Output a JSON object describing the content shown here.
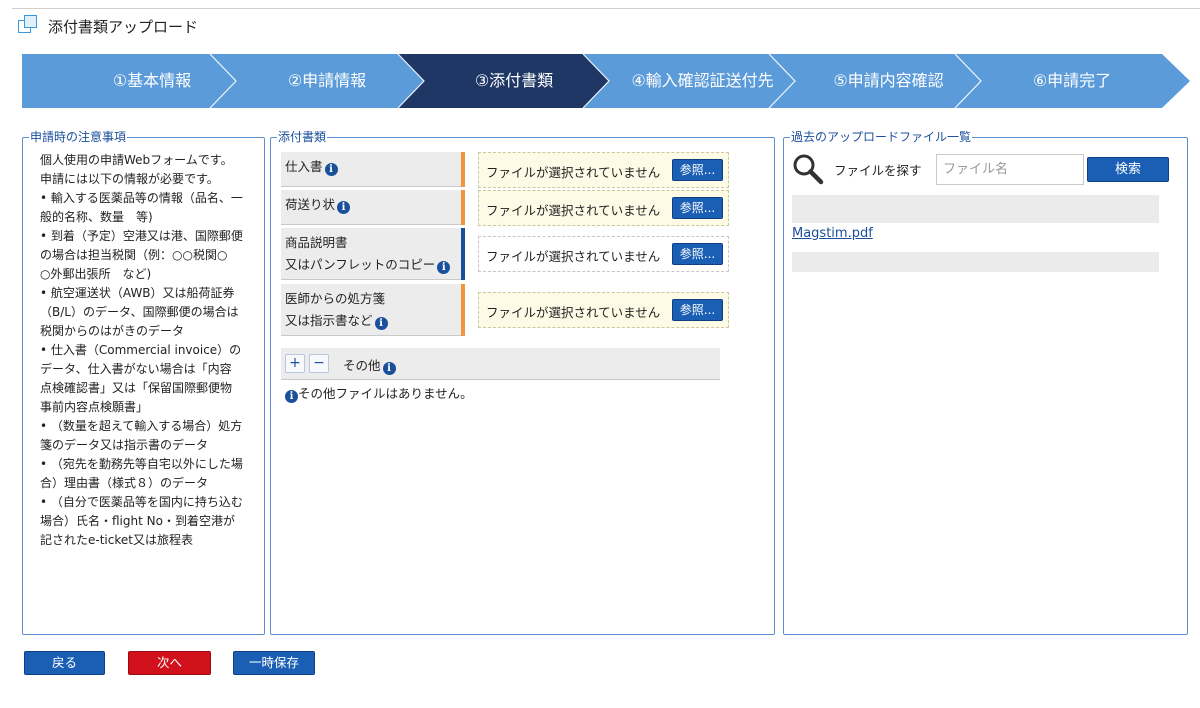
{
  "header": {
    "title": "添付書類アップロード"
  },
  "steps": [
    {
      "label": "①基本情報",
      "active": false
    },
    {
      "label": "②申請情報",
      "active": false
    },
    {
      "label": "③添付書類",
      "active": true
    },
    {
      "label": "④輸入確認証送付先",
      "active": false
    },
    {
      "label": "⑤申請内容確認",
      "active": false
    },
    {
      "label": "⑥申請完了",
      "active": false
    }
  ],
  "colors": {
    "step_inactive": "#5b9bd9",
    "step_active": "#1e3764",
    "accent": "#1a5fb4",
    "next_button": "#d0101b"
  },
  "notice": {
    "legend": "申請時の注意事項",
    "lines": [
      "個人使用の申請Webフォームです。",
      "申請には以下の情報が必要です。",
      "• 輸入する医薬品等の情報（品名、一",
      "般的名称、数量　等)",
      "• 到着（予定）空港又は港、国際郵便",
      "の場合は担当税関（例：○○税関○",
      "○外郵出張所　など)",
      "• 航空運送状（AWB）又は船荷証券",
      "（B/L）のデータ、国際郵便の場合は",
      "税関からのはがきのデータ",
      "• 仕入書（Commercial invoice）の",
      "データ、仕入書がない場合は「内容",
      "点検確認書」又は「保留国際郵便物",
      "事前内容点検願書」",
      "• （数量を超えて輸入する場合）処方",
      "箋のデータ又は指示書のデータ",
      "• （宛先を勤務先等自宅以外にした場",
      "合）理由書（様式８）のデータ",
      "• （自分で医薬品等を国内に持ち込む",
      "場合）氏名・flight No・到着空港が",
      "記されたe-ticket又は旅程表"
    ]
  },
  "attachments": {
    "legend": "添付書類",
    "docs": [
      {
        "line1": "仕入書",
        "line2": "",
        "file_status": "ファイルが選択されていません",
        "browse_label": "参照..."
      },
      {
        "line1": "荷送り状",
        "line2": "",
        "file_status": "ファイルが選択されていません",
        "browse_label": "参照..."
      },
      {
        "line1": "商品説明書",
        "line2": "又はパンフレットのコピー",
        "file_status": "ファイルが選択されていません",
        "browse_label": "参照..."
      },
      {
        "line1": "医師からの処方箋",
        "line2": "又は指示書など",
        "file_status": "ファイルが選択されていません",
        "browse_label": "参照..."
      }
    ],
    "other": {
      "plus": "+",
      "minus": "−",
      "label": "その他",
      "note": "その他ファイルはありません。"
    }
  },
  "past_uploads": {
    "legend": "過去のアップロードファイル一覧",
    "search_label": "ファイルを探す",
    "search_placeholder": "ファイル名",
    "search_button": "検索",
    "files": [
      "Magstim.pdf"
    ]
  },
  "footer": {
    "back": "戻る",
    "next": "次へ",
    "save": "一時保存"
  }
}
